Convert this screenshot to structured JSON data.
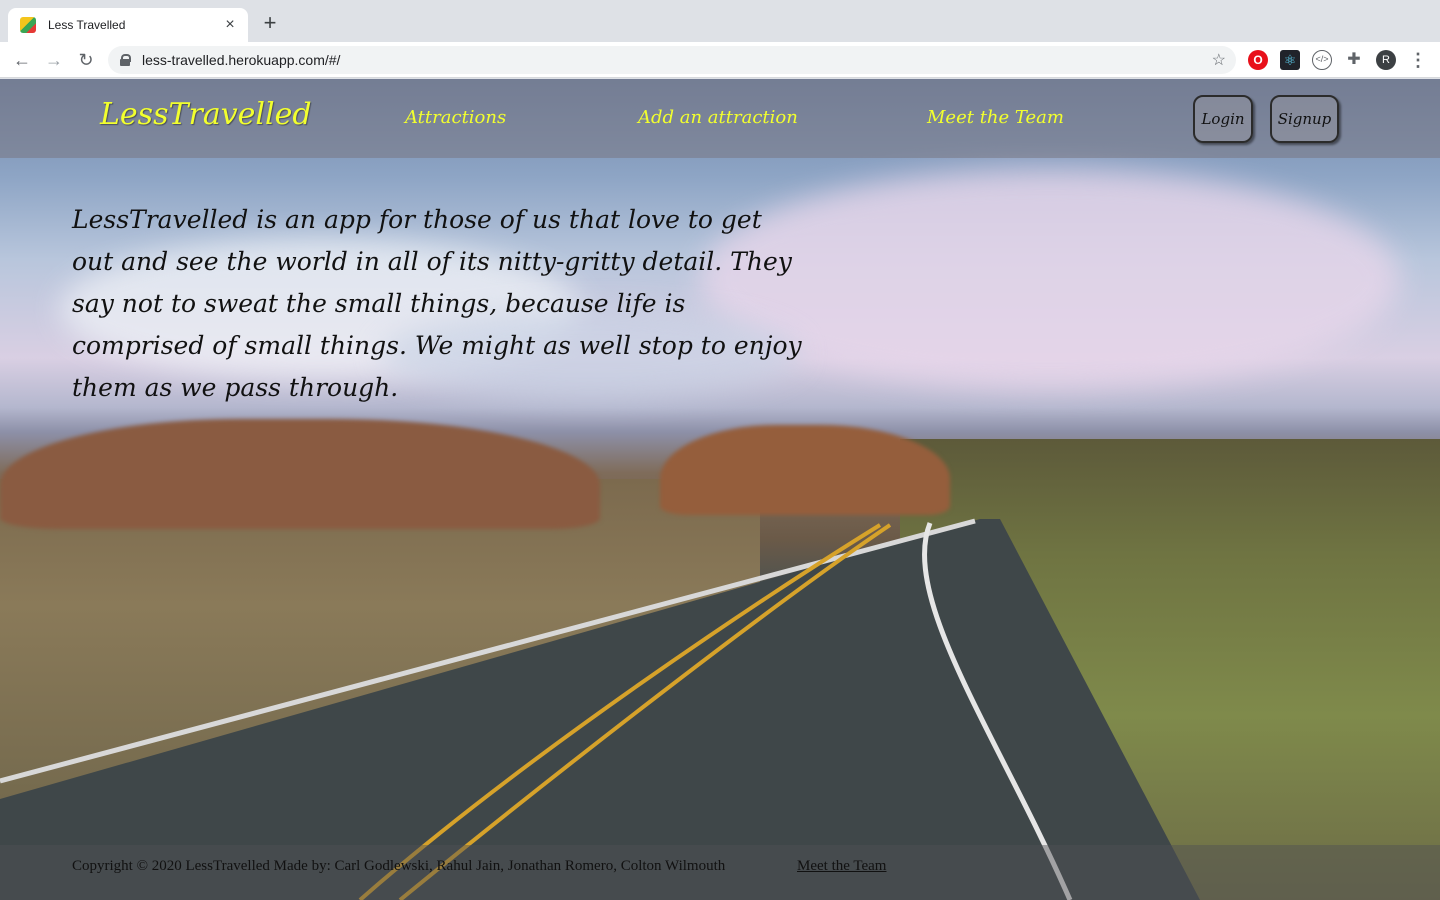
{
  "browser": {
    "tab_title": "Less Travelled",
    "new_tab_glyph": "+",
    "close_glyph": "×",
    "url": "less-travelled.herokuapp.com/#/",
    "back_glyph": "←",
    "forward_glyph": "→",
    "reload_glyph": "↻",
    "profile_initial": "R",
    "extensions": [
      "opera-icon",
      "react-devtools-icon",
      "code-icon",
      "puzzle-icon"
    ]
  },
  "navbar": {
    "brand": "LessTravelled",
    "links": [
      "Attractions",
      "Add an attraction",
      "Meet the Team"
    ],
    "login_label": "Login",
    "signup_label": "Signup",
    "link_color": "#f2ff2e"
  },
  "main": {
    "intro": "LessTravelled is an app for those of us that love to get out and see the world in all of its nitty-gritty detail. They say not to sweat the small things, because life is comprised of small things. We might as well stop to enjoy them as we pass through."
  },
  "footer": {
    "copyright": "Copyright © 2020 LessTravelled Made by: Carl Godlewski, Rahul Jain, Jonathan Romero, Colton Wilmouth",
    "team_link": "Meet the Team"
  }
}
